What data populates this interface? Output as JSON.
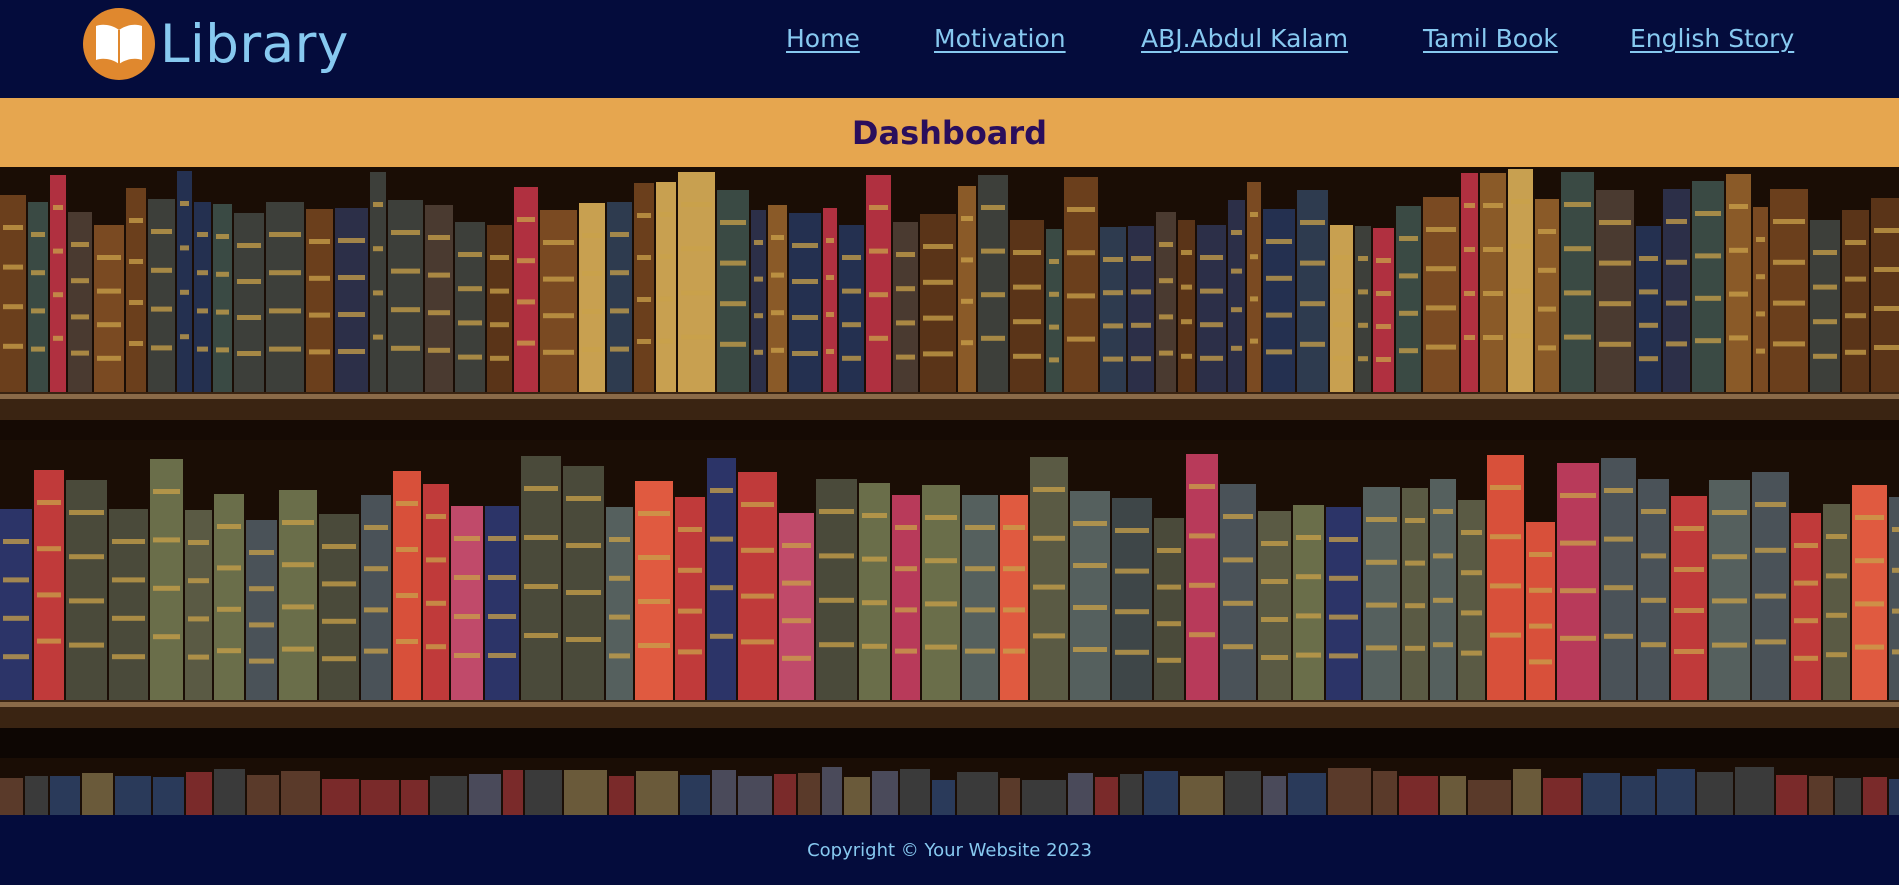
{
  "brand": {
    "name": "Library",
    "icon": "open-book-icon",
    "icon_bg_color": "#e0882e",
    "text_color": "#87c9f0"
  },
  "nav": {
    "links": [
      {
        "label": "Home"
      },
      {
        "label": "Motivation"
      },
      {
        "label": "ABJ.Abdul Kalam"
      },
      {
        "label": "Tamil Book"
      },
      {
        "label": "English Story"
      }
    ]
  },
  "banner": {
    "title": "Dashboard",
    "bg_color": "#e6a64f",
    "text_color": "#2a0e5c"
  },
  "hero": {
    "image": "bookshelf-photo"
  },
  "footer": {
    "text": "Copyright © Your Website 2023"
  },
  "colors": {
    "navy": "#040c3c",
    "link": "#87c9f0"
  }
}
